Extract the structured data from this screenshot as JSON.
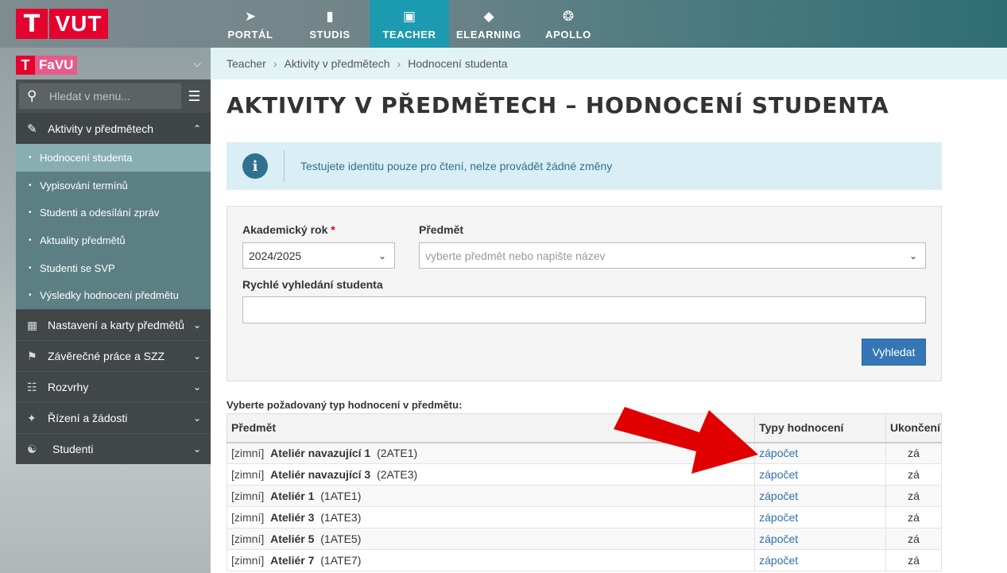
{
  "logo": {
    "t": "T",
    "text": "VUT"
  },
  "topnav": [
    {
      "icon": "➤",
      "label": "PORTÁL"
    },
    {
      "icon": "▮",
      "label": "STUDIS"
    },
    {
      "icon": "▣",
      "label": "TEACHER"
    },
    {
      "icon": "◆",
      "label": "ELEARNING"
    },
    {
      "icon": "❂",
      "label": "APOLLO"
    }
  ],
  "faculty": {
    "t": "T",
    "name": "FaVU",
    "chev": "⌄"
  },
  "sidebar": {
    "search_placeholder": "Hledat v menu...",
    "active_section": "Aktivity v předmětech",
    "sub_items": [
      "Hodnocení studenta",
      "Vypisování termínů",
      "Studenti a odesílání zpráv",
      "Aktuality předmětů",
      "Studenti se SVP",
      "Výsledky hodnocení předmětu"
    ],
    "sections": [
      "Nastavení a karty předmětů",
      "Závěrečné práce a SZZ",
      "Rozvrhy",
      "Řízení a žádosti",
      "Studenti"
    ]
  },
  "breadcrumb": [
    "Teacher",
    "Aktivity v předmětech",
    "Hodnocení studenta"
  ],
  "page_title": "AKTIVITY V PŘEDMĚTECH – HODNOCENÍ STUDENTA",
  "alert": {
    "icon": "i",
    "text": "Testujete identitu pouze pro čtení, nelze provádět žádné změny"
  },
  "form": {
    "year_label": "Akademický rok",
    "year_required": "*",
    "year_value": "2024/2025",
    "subject_label": "Předmět",
    "subject_placeholder": "vyberte předmět nebo napište název",
    "quick_label": "Rychlé vyhledání studenta",
    "quick_value": "",
    "search_button": "Vyhledat"
  },
  "table": {
    "caption": "Vyberte požadovaný typ hodnocení v předmětu:",
    "headers": [
      "Předmět",
      "Typy hodnocení",
      "Ukončení"
    ],
    "rows": [
      {
        "sem": "[zimní]",
        "name": "Ateliér navazující 1",
        "code": "(2ATE1)",
        "type": "zápočet",
        "end": "zá"
      },
      {
        "sem": "[zimní]",
        "name": "Ateliér navazující 3",
        "code": "(2ATE3)",
        "type": "zápočet",
        "end": "zá"
      },
      {
        "sem": "[zimní]",
        "name": "Ateliér 1",
        "code": "(1ATE1)",
        "type": "zápočet",
        "end": "zá"
      },
      {
        "sem": "[zimní]",
        "name": "Ateliér 3",
        "code": "(1ATE3)",
        "type": "zápočet",
        "end": "zá"
      },
      {
        "sem": "[zimní]",
        "name": "Ateliér 5",
        "code": "(1ATE5)",
        "type": "zápočet",
        "end": "zá"
      },
      {
        "sem": "[zimní]",
        "name": "Ateliér 7",
        "code": "(1ATE7)",
        "type": "zápočet",
        "end": "zá"
      }
    ]
  },
  "colors": {
    "accent": "#1c9bb0",
    "brand_red": "#e4032e",
    "link": "#2f6fae",
    "arrow": "#e00000"
  }
}
